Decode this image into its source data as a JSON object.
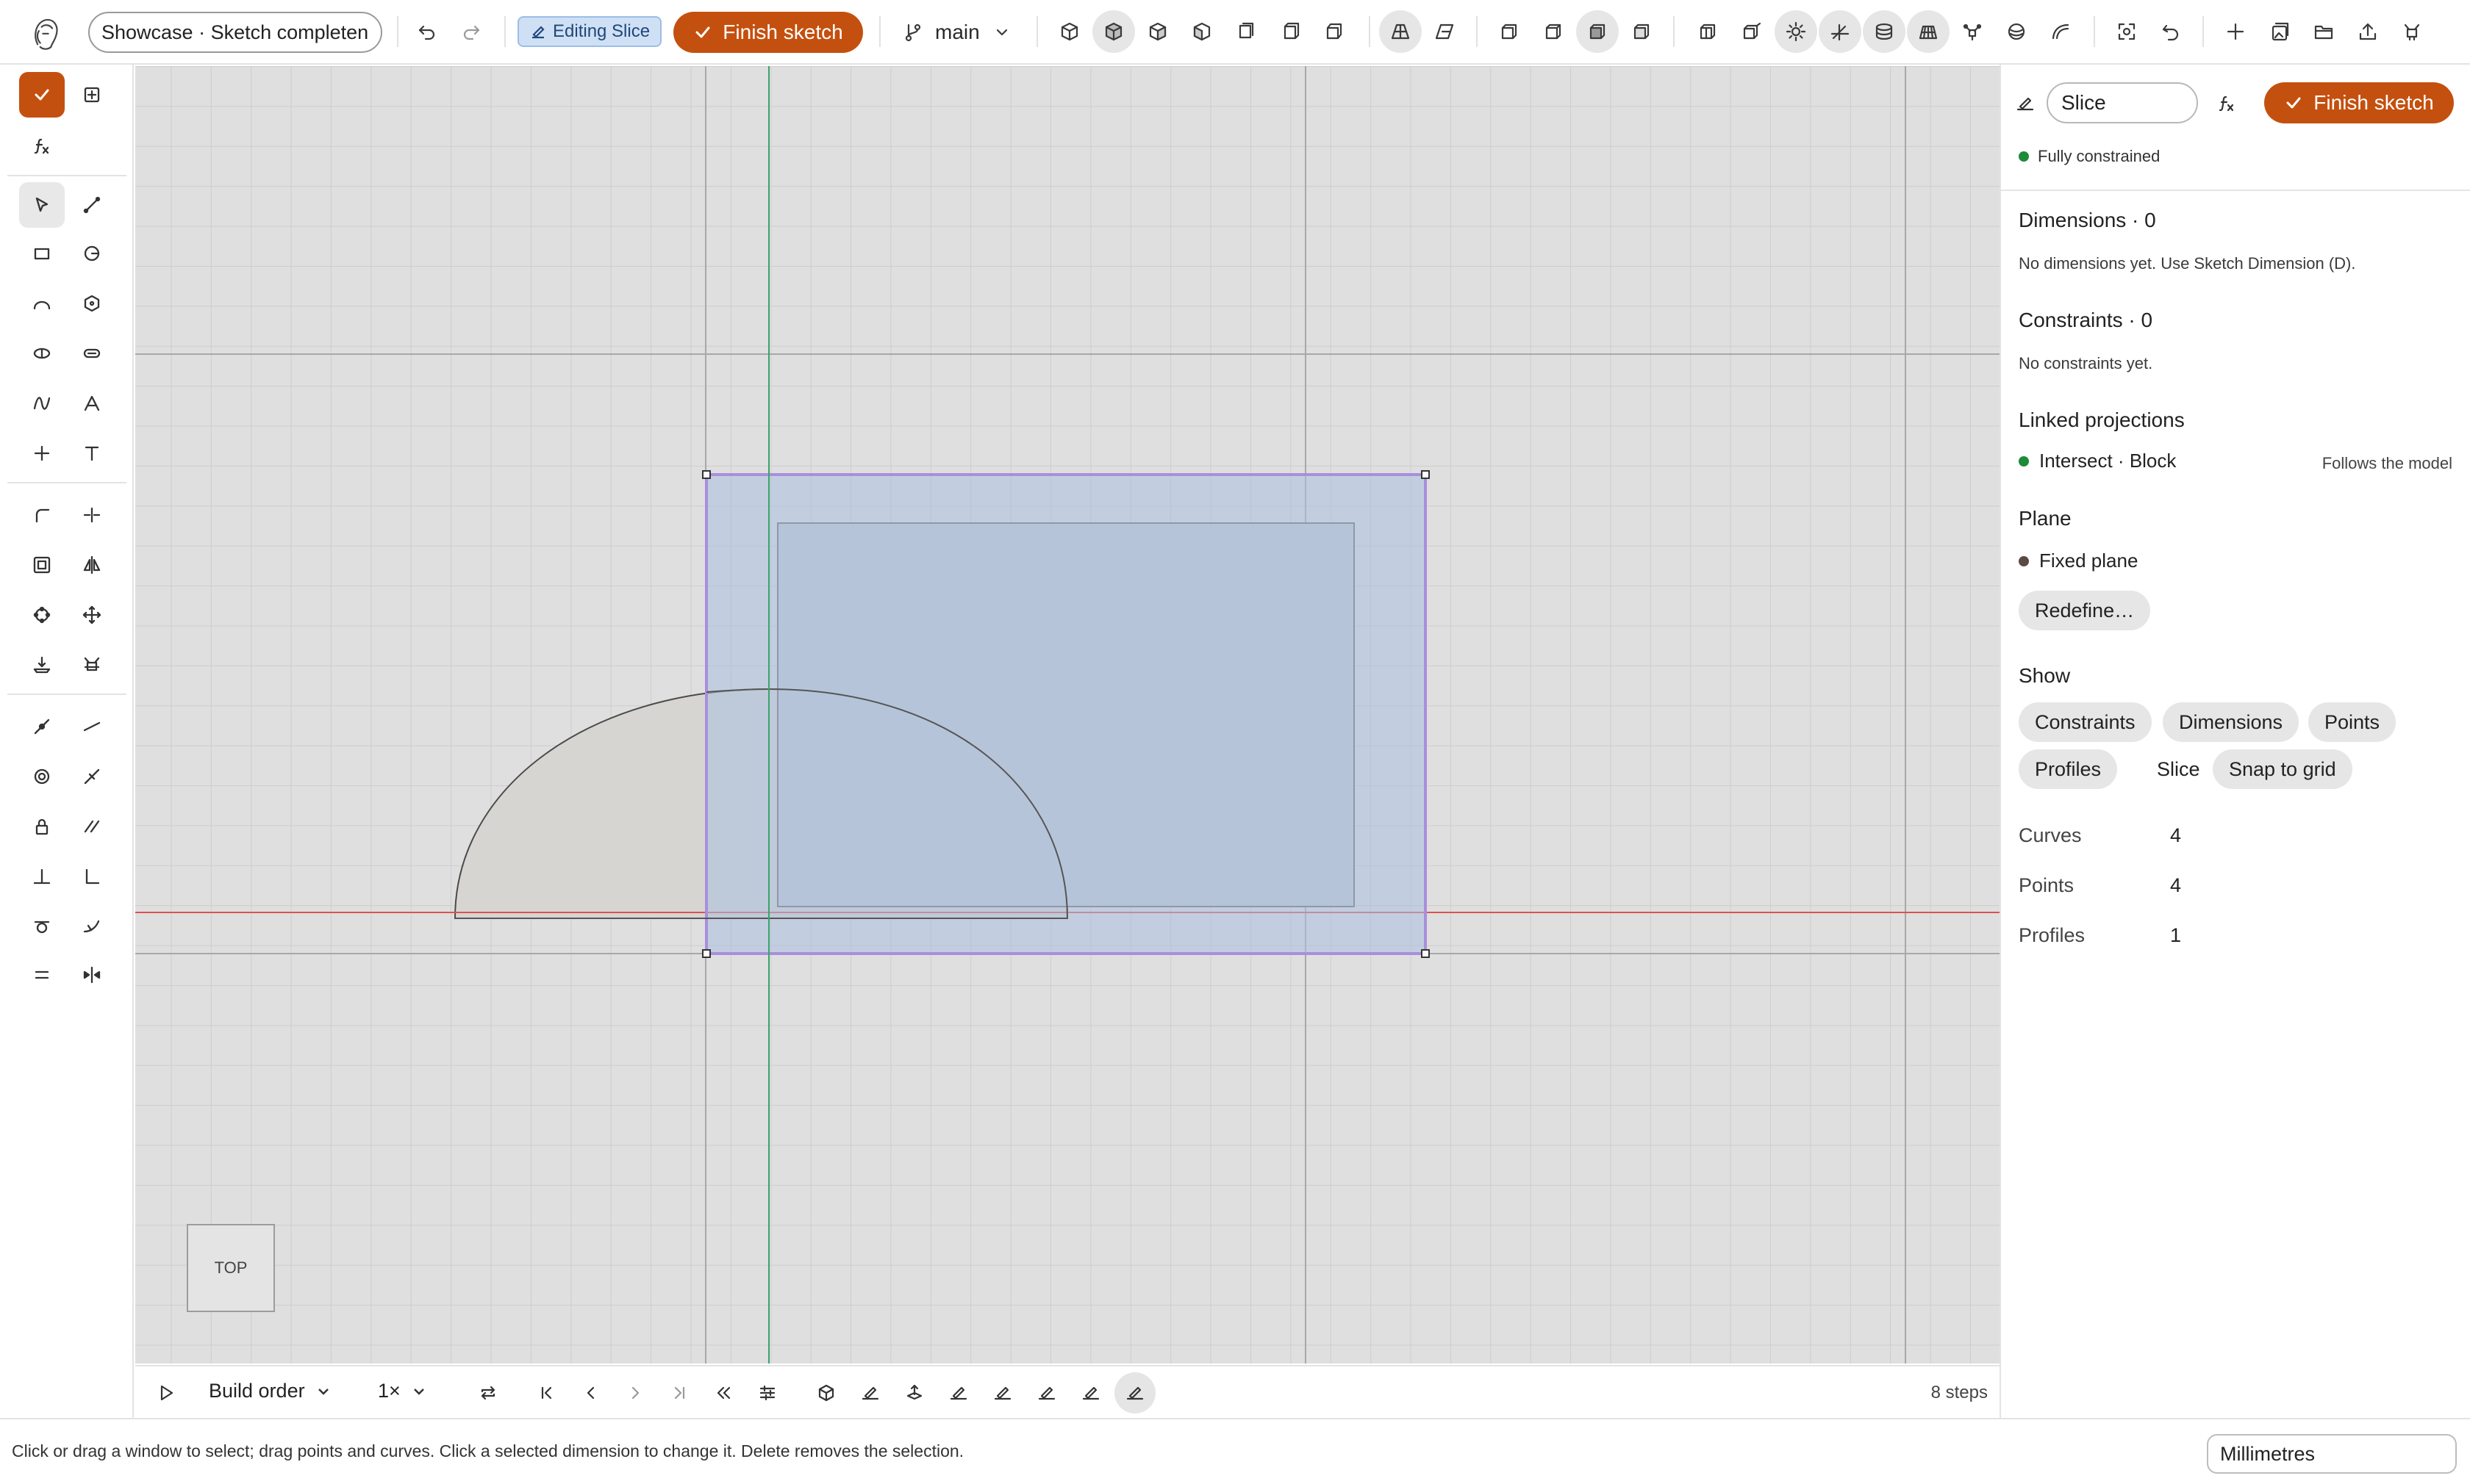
{
  "topbar": {
    "doc_name": "Showcase · Sketch completen",
    "editing_badge": "Editing Slice",
    "finish_label": "Finish sketch",
    "branch": "main"
  },
  "viewport": {
    "view_cube_label": "TOP"
  },
  "timeline": {
    "mode_label": "Build order",
    "speed": "1×",
    "steps": "8 steps"
  },
  "panel": {
    "name_value": "Slice",
    "finish_label": "Finish sketch",
    "status": "Fully constrained",
    "dimensions_title": "Dimensions · 0",
    "dimensions_hint": "No dimensions yet. Use Sketch Dimension (D).",
    "constraints_title": "Constraints · 0",
    "constraints_hint": "No constraints yet.",
    "linked_title": "Linked projections",
    "linked_item": "Intersect · Block",
    "linked_note": "Follows the model",
    "plane_title": "Plane",
    "plane_item": "Fixed plane",
    "redefine_label": "Redefine…",
    "show_title": "Show",
    "show_chips": [
      "Constraints",
      "Dimensions",
      "Points",
      "Profiles",
      "Slice",
      "Snap to grid"
    ],
    "stats": [
      {
        "label": "Curves",
        "value": "4"
      },
      {
        "label": "Points",
        "value": "4"
      },
      {
        "label": "Profiles",
        "value": "1"
      }
    ]
  },
  "statusbar": {
    "hint": "Click or drag a window to select; drag points and curves. Click a selected dimension to change it. Delete removes the selection.",
    "units": "Millimetres"
  },
  "colors": {
    "accent": "#c4500f",
    "status_green": "#1e8a3a",
    "selection_purple": "#a88fdc",
    "x_axis": "#d9534f",
    "y_axis": "#3aa36a"
  }
}
